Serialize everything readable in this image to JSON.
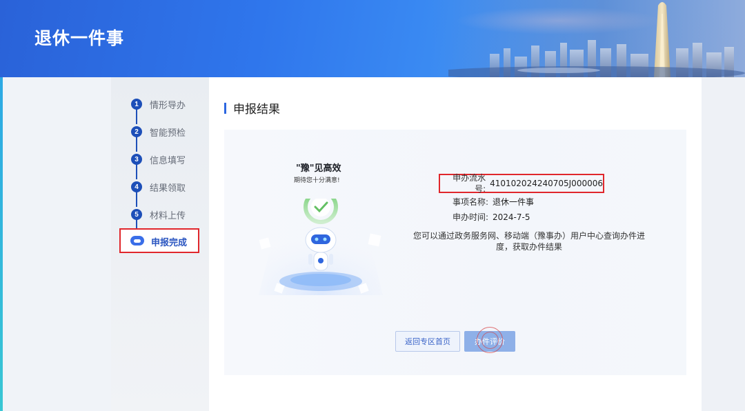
{
  "header": {
    "title": "退休一件事"
  },
  "steps": [
    {
      "num": "1",
      "label": "情形导办"
    },
    {
      "num": "2",
      "label": "智能预检"
    },
    {
      "num": "3",
      "label": "信息填写"
    },
    {
      "num": "4",
      "label": "结果领取"
    },
    {
      "num": "5",
      "label": "材料上传"
    }
  ],
  "current_step": {
    "label": "申报完成",
    "icon": "robot-icon"
  },
  "main": {
    "section_title": "申报结果",
    "slogan_main": "\"豫\"见高效",
    "slogan_sub": "期待您十分满意!",
    "serial_label": "申办流水号:",
    "serial_value": "410102024240705J000006",
    "item_label": "事项名称:",
    "item_value": "退休一件事",
    "time_label": "申办时间:",
    "time_value": "2024-7-5",
    "notice": "您可以通过政务服务网、移动端（豫事办）用户中心查询办件进度，获取办件结果",
    "btn_home": "返回专区首页",
    "btn_rate": "办件评价"
  },
  "colors": {
    "accent": "#2c66e0",
    "step": "#1d4fb8",
    "highlight_border": "#e0262b"
  }
}
